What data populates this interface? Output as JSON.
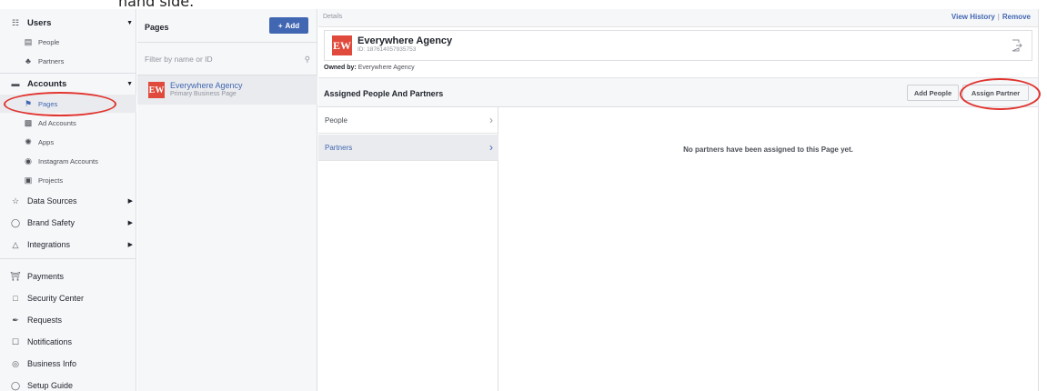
{
  "caption": "hand side.",
  "sidebar": {
    "users": {
      "label": "Users",
      "icon": "users-icon"
    },
    "people": {
      "label": "People",
      "icon": "people-icon"
    },
    "partners": {
      "label": "Partners",
      "icon": "partners-icon"
    },
    "accounts": {
      "label": "Accounts",
      "icon": "briefcase-icon"
    },
    "pages": {
      "label": "Pages",
      "icon": "flag-icon"
    },
    "ad_accounts": {
      "label": "Ad Accounts",
      "icon": "ad-accounts-icon"
    },
    "apps": {
      "label": "Apps",
      "icon": "apps-icon"
    },
    "instagram": {
      "label": "Instagram Accounts",
      "icon": "instagram-icon"
    },
    "projects": {
      "label": "Projects",
      "icon": "folder-icon"
    },
    "data_sources": {
      "label": "Data Sources",
      "icon": "data-sources-icon"
    },
    "brand_safety": {
      "label": "Brand Safety",
      "icon": "shield-icon"
    },
    "integrations": {
      "label": "Integrations",
      "icon": "integrations-icon"
    },
    "payments": {
      "label": "Payments",
      "icon": "bank-icon"
    },
    "security": {
      "label": "Security Center",
      "icon": "lock-icon"
    },
    "requests": {
      "label": "Requests",
      "icon": "pen-icon"
    },
    "notifications": {
      "label": "Notifications",
      "icon": "bell-icon"
    },
    "business_info": {
      "label": "Business Info",
      "icon": "info-icon"
    },
    "setup_guide": {
      "label": "Setup Guide",
      "icon": "question-icon"
    }
  },
  "pages_panel": {
    "title": "Pages",
    "add_label": "Add",
    "filter_placeholder": "Filter by name or ID",
    "item": {
      "logo": "EW",
      "name": "Everywhere Agency",
      "subtitle": "Primary Business Page"
    }
  },
  "details": {
    "label": "Details",
    "view_history": "View History",
    "separator": "|",
    "remove": "Remove",
    "page_name": "Everywhere Agency",
    "page_id": "ID: 187614057935753",
    "owned_label": "Owned by:",
    "owned_value": "Everywhere Agency",
    "assigned_title": "Assigned People And Partners",
    "add_people": "Add People",
    "assign_partner": "Assign Partner",
    "tab_people": "People",
    "tab_partners": "Partners",
    "empty_message": "No partners have been assigned to this Page yet."
  },
  "colors": {
    "accent": "#4267b2",
    "highlight": "#e0342f",
    "logo": "#e04a3c"
  }
}
